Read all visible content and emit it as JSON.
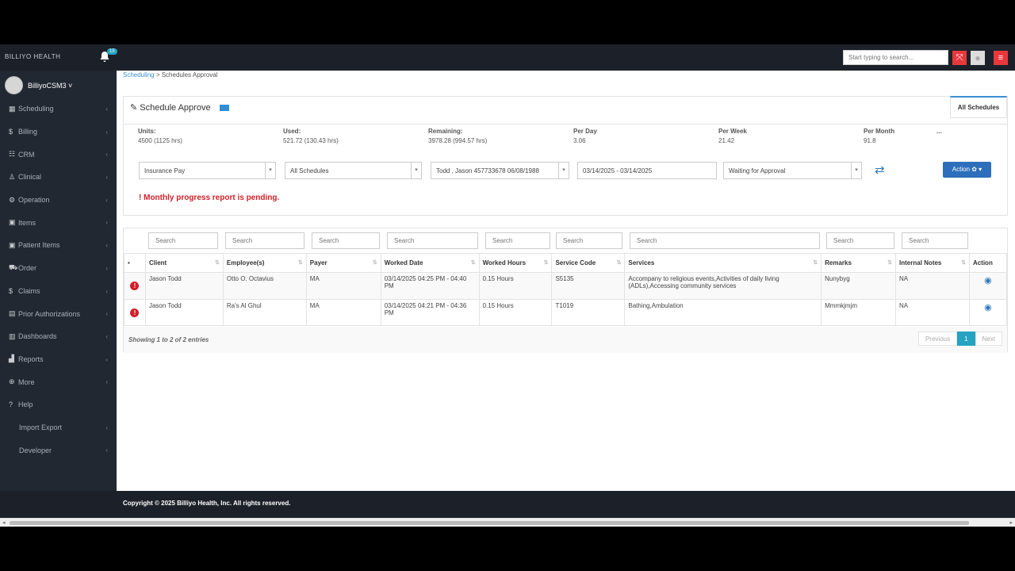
{
  "topbar": {
    "brand": "BILLIYO HEALTH",
    "notification_count": "15",
    "search_placeholder": "Start typing to search..."
  },
  "sidebar": {
    "user_name": "BilliyoCSM3 ˅",
    "items": [
      {
        "icon": "calendar-icon",
        "glyph": "▦",
        "label": "Scheduling"
      },
      {
        "icon": "dollar-icon",
        "glyph": "$",
        "label": "Billing"
      },
      {
        "icon": "users-icon",
        "glyph": "☷",
        "label": "CRM"
      },
      {
        "icon": "user-md-icon",
        "glyph": "♙",
        "label": "Clinical"
      },
      {
        "icon": "sitemap-icon",
        "glyph": "⚙",
        "label": "Operation"
      },
      {
        "icon": "box-icon",
        "glyph": "▣",
        "label": "Items"
      },
      {
        "icon": "box-icon",
        "glyph": "▣",
        "label": "Patient Items"
      },
      {
        "icon": "cart-icon",
        "glyph": "⛟",
        "label": "Order"
      },
      {
        "icon": "dollar-icon",
        "glyph": "$",
        "label": "Claims"
      },
      {
        "icon": "key-icon",
        "glyph": "▤",
        "label": "Prior Authorizations"
      },
      {
        "icon": "dashboard-icon",
        "glyph": "▥",
        "label": "Dashboards"
      },
      {
        "icon": "chart-icon",
        "glyph": "▟",
        "label": "Reports"
      },
      {
        "icon": "plus-circle-icon",
        "glyph": "⊕",
        "label": "More"
      },
      {
        "icon": "question-icon",
        "glyph": "?",
        "label": "Help"
      },
      {
        "icon": "",
        "glyph": "",
        "label": "Import Export"
      },
      {
        "icon": "",
        "glyph": "",
        "label": "Developer"
      }
    ]
  },
  "breadcrumb": {
    "parent": "Scheduling",
    "current": "> Schedules Approval"
  },
  "panel": {
    "title": "Schedule Approve",
    "tab": "All Schedules",
    "stats": [
      {
        "label": "Units:",
        "value": "4500 (1125 hrs)"
      },
      {
        "label": "Used:",
        "value": "521.72 (130.43 hrs)"
      },
      {
        "label": "Remaining:",
        "value": "3978.28 (994.57 hrs)"
      },
      {
        "label": "Per Day",
        "value": "3.06"
      },
      {
        "label": "Per Week",
        "value": "21.42"
      },
      {
        "label": "Per Month",
        "value": "91.8"
      },
      {
        "label": "...",
        "value": ""
      }
    ],
    "filters": {
      "payer": "Insurance Pay",
      "schedules": "All Schedules",
      "client": "Todd , Jason 457733678 06/08/1988",
      "date_range": "03/14/2025 - 03/14/2025",
      "status": "Waiting for Approval"
    },
    "action_label": "Action ✿ ▾",
    "alert": "! Monthly progress report is pending."
  },
  "table": {
    "search_placeholder": "Search",
    "headers": [
      "Client",
      "Employee(s)",
      "Payer",
      "Worked Date",
      "Worked Hours",
      "Service Code",
      "Services",
      "Remarks",
      "Internal Notes",
      "Action"
    ],
    "rows": [
      {
        "client": "Jason Todd",
        "employee": "Otto O. Octavius",
        "payer": "MA",
        "worked_date": "03/14/2025 04:25 PM - 04:40 PM",
        "worked_hours": "0.15 Hours",
        "service_code": "S5135",
        "services": "Accompany to religious events,Activities of daily living (ADLs),Accessing community services",
        "remarks": "Nunybyg",
        "internal_notes": "NA"
      },
      {
        "client": "Jason Todd",
        "employee": "Ra's Al Ghul",
        "payer": "MA",
        "worked_date": "03/14/2025 04:21 PM - 04:36 PM",
        "worked_hours": "0.15 Hours",
        "service_code": "T1019",
        "services": "Bathing,Ambulation",
        "remarks": "Mmmkjmjm",
        "internal_notes": "NA"
      }
    ],
    "showing": "Showing 1 to 2 of 2 entries",
    "pager": {
      "prev": "Previous",
      "page": "1",
      "next": "Next"
    }
  },
  "footer": {
    "copyright": "Copyright © 2025 Billiyo Health, Inc. All rights reserved."
  }
}
